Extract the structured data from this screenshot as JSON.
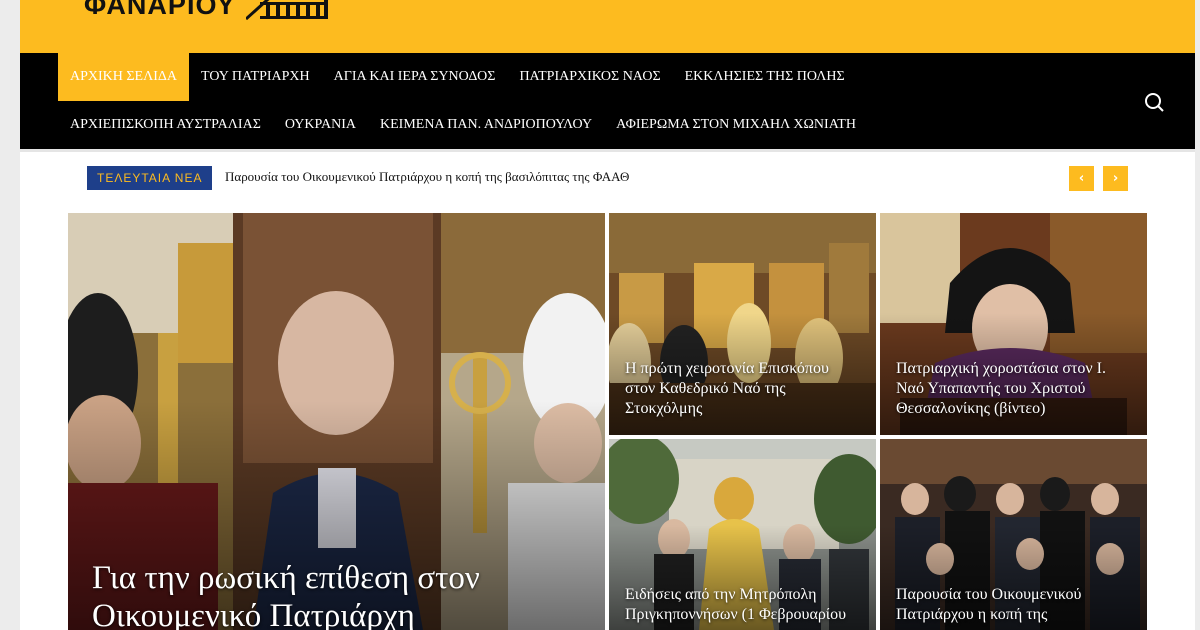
{
  "logo": {
    "text": "ΦΑΝΑΡΙΟΥ"
  },
  "nav": {
    "row1": [
      {
        "label": "ΑΡΧΙΚΗ ΣΕΛΙΔΑ",
        "active": true
      },
      {
        "label": "ΤΟΥ ΠΑΤΡΙΑΡΧΗ"
      },
      {
        "label": "ΑΓΙΑ ΚΑΙ ΙΕΡΑ ΣΥΝΟΔΟΣ"
      },
      {
        "label": "ΠΑΤΡΙΑΡΧΙΚΟΣ ΝΑΟΣ"
      },
      {
        "label": "ΕΚΚΛΗΣΙΕΣ ΤΗΣ ΠΟΛΗΣ"
      }
    ],
    "row2": [
      {
        "label": "ΑΡΧΙΕΠΙΣΚΟΠΗ ΑΥΣΤΡΑΛΙΑΣ"
      },
      {
        "label": "ΟΥΚΡΑΝΙΑ"
      },
      {
        "label": "ΚΕΙΜΕΝΑ ΠΑΝ. ΑΝΔΡΙΟΠΟΥΛΟΥ"
      },
      {
        "label": "ΑΦΙΕΡΩΜΑ ΣΤΟΝ ΜΙΧΑΗΛ ΧΩΝΙΑΤΗ"
      }
    ],
    "search_icon": "search-icon"
  },
  "ticker": {
    "label": "ΤΕΛΕΥΤΑΙΑ ΝΕΑ",
    "headline": "Παρουσία του Οικουμενικού Πατριάρχου η κοπή της βασιλόπιτας της ΦΑΑΘ",
    "prev_icon": "chevron-left-icon",
    "next_icon": "chevron-right-icon"
  },
  "featured": {
    "main": {
      "title": "Για την ρωσική επίθεση στον Οικουμενικό Πατριάρχη"
    },
    "top_middle": {
      "title": "Η πρώτη χειροτονία Επισκόπου στον Καθεδρικό Ναό της Στοκχόλμης"
    },
    "top_right": {
      "title": "Πατριαρχική χοροστάσια στον Ι. Ναό Υπαπαντής του Χριστού Θεσσαλονίκης (βίντεο)"
    },
    "bottom_middle": {
      "title": "Ειδήσεις από την Μητρόπολη Πριγκηποννήσων (1 Φεβρουαρίου"
    },
    "bottom_right": {
      "title": "Παρουσία του Οικουμενικού Πατριάρχου η κοπή της"
    }
  },
  "colors": {
    "brand_yellow": "#fdbb1f",
    "nav_bg": "#000000",
    "ticker_label_bg": "#1e3f8a"
  }
}
